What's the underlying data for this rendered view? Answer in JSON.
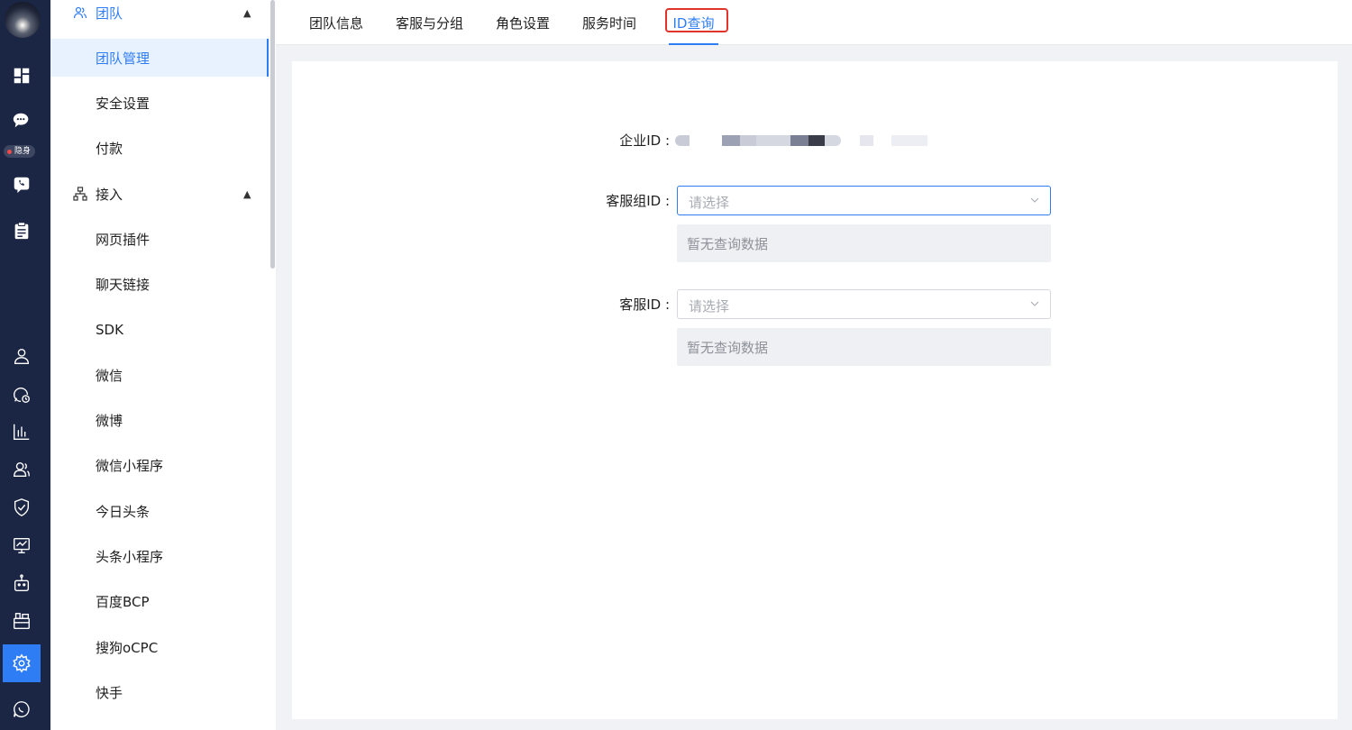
{
  "rail": {
    "status_badge": "隐身",
    "icons": [
      "dashboard-icon",
      "chat-icon",
      "phone-chat-icon",
      "clipboard-icon",
      "user-icon",
      "history-icon",
      "bar-chart-icon",
      "team-icon",
      "shield-icon",
      "monitor-chart-icon",
      "robot-icon",
      "toolbox-icon",
      "settings-icon",
      "message-icon"
    ],
    "active_icon": "settings-icon"
  },
  "subnav": {
    "group_team": {
      "label": "团队",
      "icon": "team-group-icon"
    },
    "team_items": [
      "团队管理",
      "安全设置",
      "付款"
    ],
    "group_access": {
      "label": "接入",
      "icon": "sitemap-icon"
    },
    "access_items": [
      "网页插件",
      "聊天链接",
      "SDK",
      "微信",
      "微博",
      "微信小程序",
      "今日头条",
      "头条小程序",
      "百度BCP",
      "搜狗oCPC",
      "快手"
    ],
    "active_item": "团队管理"
  },
  "tabs": {
    "items": [
      "团队信息",
      "客服与分组",
      "角色设置",
      "服务时间",
      "ID查询"
    ],
    "active": "ID查询"
  },
  "form": {
    "enterprise_id_label": "企业ID :",
    "group_id_label": "客服组ID :",
    "group_select_placeholder": "请选择",
    "group_result_empty": "暂无查询数据",
    "agent_id_label": "客服ID :",
    "agent_select_placeholder": "请选择",
    "agent_result_empty": "暂无查询数据"
  },
  "colors": {
    "accent": "#2f7df5",
    "rail_bg": "#1b2544",
    "highlight_box": "#e0352b"
  }
}
